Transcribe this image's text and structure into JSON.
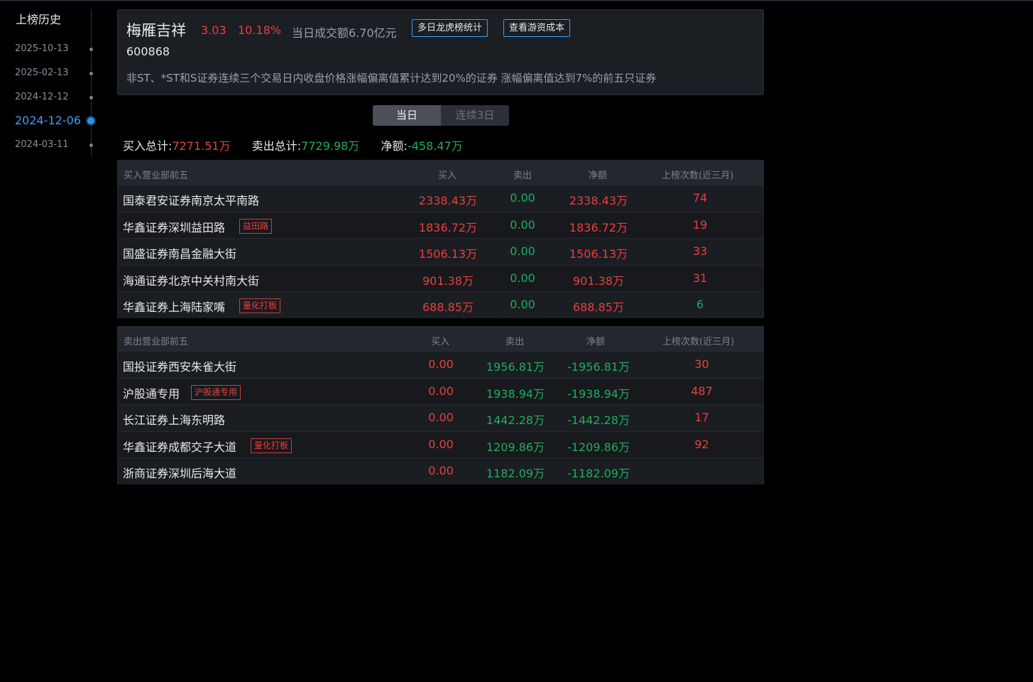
{
  "sidebar": {
    "title": "上榜历史",
    "items": [
      {
        "date": "2025-10-13",
        "active": false
      },
      {
        "date": "2025-02-13",
        "active": false
      },
      {
        "date": "2024-12-12",
        "active": false
      },
      {
        "date": "2024-12-06",
        "active": true
      },
      {
        "date": "2024-03-11",
        "active": false
      }
    ]
  },
  "header": {
    "name": "梅雁吉祥",
    "price": "3.03",
    "change_pct": "10.18%",
    "turnover": "当日成交额6.70亿元",
    "btn_multi": "多日龙虎榜统计",
    "btn_cost": "查看游资成本",
    "code": "600868",
    "reason": "非ST、*ST和S证券连续三个交易日内收盘价格涨幅偏离值累计达到20%的证券 涨幅偏离值达到7%的前五只证券"
  },
  "toggle": {
    "day": "当日",
    "three": "连续3日"
  },
  "totals": {
    "buy_label": "买入总计:",
    "buy_value": "7271.51万",
    "sell_label": "卖出总计:",
    "sell_value": "7729.98万",
    "net_label": "净额:",
    "net_value": "-458.47万"
  },
  "buy_table": {
    "headers": [
      "买入营业部前五",
      "买入",
      "卖出",
      "净额",
      "上榜次数(近三月)"
    ],
    "rows": [
      {
        "name": "国泰君安证券南京太平南路",
        "tag": "",
        "buy": "2338.43万",
        "sell": "0.00",
        "net": "2338.43万",
        "count": "74"
      },
      {
        "name": "华鑫证券深圳益田路",
        "tag": "益田路",
        "buy": "1836.72万",
        "sell": "0.00",
        "net": "1836.72万",
        "count": "19"
      },
      {
        "name": "国盛证券南昌金融大街",
        "tag": "",
        "buy": "1506.13万",
        "sell": "0.00",
        "net": "1506.13万",
        "count": "33"
      },
      {
        "name": "海通证券北京中关村南大街",
        "tag": "",
        "buy": "901.38万",
        "sell": "0.00",
        "net": "901.38万",
        "count": "31"
      },
      {
        "name": "华鑫证券上海陆家嘴",
        "tag": "量化打板",
        "buy": "688.85万",
        "sell": "0.00",
        "net": "688.85万",
        "count": "6"
      }
    ]
  },
  "sell_table": {
    "headers": [
      "卖出营业部前五",
      "买入",
      "卖出",
      "净额",
      "上榜次数(近三月)"
    ],
    "rows": [
      {
        "name": "国投证券西安朱雀大街",
        "tag": "",
        "buy": "0.00",
        "sell": "1956.81万",
        "net": "-1956.81万",
        "count": "30"
      },
      {
        "name": "沪股通专用",
        "tag": "沪股通专用",
        "buy": "0.00",
        "sell": "1938.94万",
        "net": "-1938.94万",
        "count": "487"
      },
      {
        "name": "长江证券上海东明路",
        "tag": "",
        "buy": "0.00",
        "sell": "1442.28万",
        "net": "-1442.28万",
        "count": "17"
      },
      {
        "name": "华鑫证券成都交子大道",
        "tag": "量化打板",
        "buy": "0.00",
        "sell": "1209.86万",
        "net": "-1209.86万",
        "count": "92"
      },
      {
        "name": "浙商证券深圳后海大道",
        "tag": "",
        "buy": "0.00",
        "sell": "1182.09万",
        "net": "-1182.09万",
        "count": ""
      }
    ]
  },
  "colors": {
    "up": "#e8403c",
    "down": "#1fae5b",
    "accent": "#3d9ef2"
  }
}
